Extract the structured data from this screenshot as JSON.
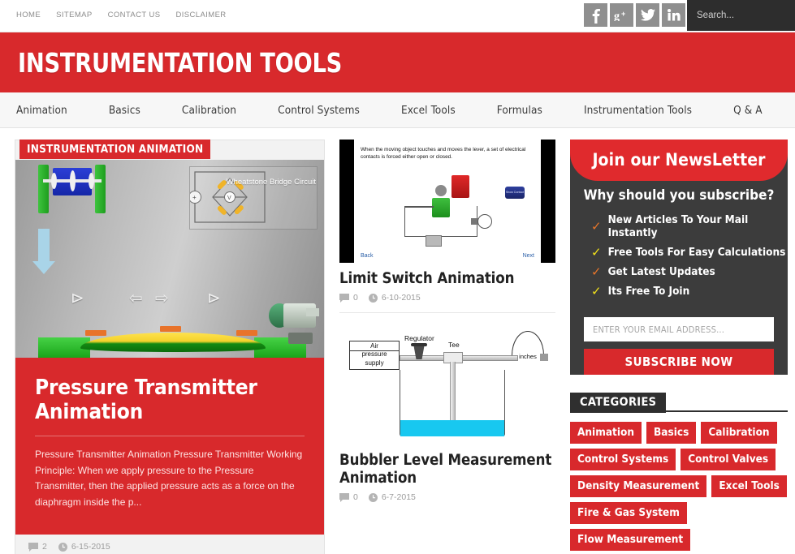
{
  "topbar": {
    "links": [
      "HOME",
      "SITEMAP",
      "CONTACT US",
      "DISCLAIMER"
    ],
    "social": [
      {
        "name": "facebook-icon",
        "glyph": "f"
      },
      {
        "name": "googleplus-icon",
        "glyph": "g+"
      },
      {
        "name": "twitter-icon",
        "glyph": "t"
      },
      {
        "name": "linkedin-icon",
        "glyph": "in"
      }
    ],
    "search_placeholder": "Search...",
    "search_value": ""
  },
  "header": {
    "site_title": "INSTRUMENTATION TOOLS"
  },
  "mainnav": {
    "items": [
      "Animation",
      "Basics",
      "Calibration",
      "Control Systems",
      "Excel Tools",
      "Formulas",
      "Instrumentation Tools",
      "Q & A"
    ]
  },
  "featured": {
    "badge": "INSTRUMENTATION ANIMATION",
    "image_caption": "Wheatstone Bridge Circuit",
    "title": "Pressure Transmitter Animation",
    "excerpt": "Pressure Transmitter Animation Pressure Transmitter Working Principle: When we apply pressure to the Pressure Transmitter, then the applied pressure acts as a force on the diaphragm inside the p...",
    "comments": "2",
    "date": "6-15-2015"
  },
  "posts": [
    {
      "thumb_text": "When the moving object touches and moves the lever, a set of electrical contacts is forced either open or closed.",
      "thumb_back": "Back",
      "thumb_next": "Next",
      "thumb_button": "Show Contact",
      "title": "Limit Switch Animation",
      "comments": "0",
      "date": "6-10-2015"
    },
    {
      "labels": {
        "supply_line1": "Air",
        "supply_line2": "pressure",
        "supply_line3": "supply",
        "regulator": "Regulator",
        "tee": "Tee",
        "gauge": "inches"
      },
      "title": "Bubbler Level Measurement Animation",
      "comments": "0",
      "date": "6-7-2015"
    }
  ],
  "newsletter": {
    "heading": "Join our NewsLetter",
    "subheading": "Why should you subscribe?",
    "benefits": [
      {
        "text": "New Articles To Your Mail Instantly",
        "check_color": "#e8762a"
      },
      {
        "text": "Free Tools For Easy Calculations",
        "check_color": "#f3e21a"
      },
      {
        "text": "Get Latest Updates",
        "check_color": "#e8762a"
      },
      {
        "text": "Its Free To Join",
        "check_color": "#f3e21a"
      }
    ],
    "email_placeholder": "ENTER YOUR EMAIL ADDRESS...",
    "email_value": "",
    "button_label": "SUBSCRIBE NOW"
  },
  "categories": {
    "title": "CATEGORIES",
    "items": [
      "Animation",
      "Basics",
      "Calibration",
      "Control Systems",
      "Control Valves",
      "Density Measurement",
      "Excel Tools",
      "Fire & Gas System",
      "Flow Measurement"
    ]
  },
  "colors": {
    "brand_red": "#d8292c",
    "dark": "#2f2f2f",
    "panel_dark": "#3c3c3c"
  }
}
